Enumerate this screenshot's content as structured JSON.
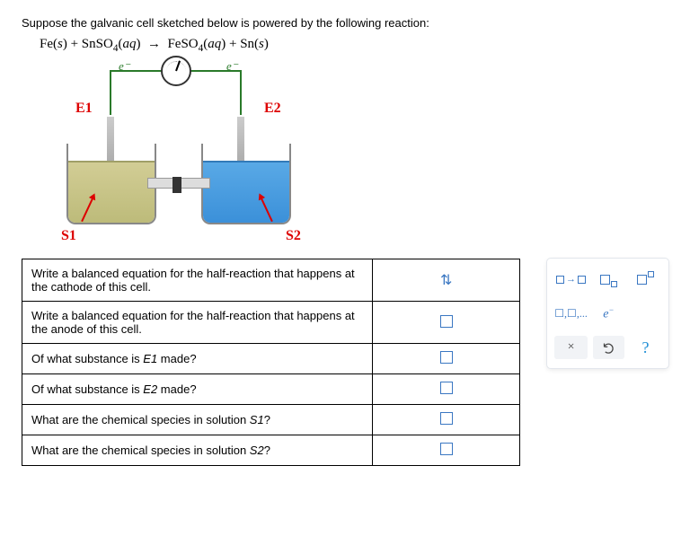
{
  "prompt": "Suppose the galvanic cell sketched below is powered by the following reaction:",
  "equation_html": "Fe(<span class='ital'>s</span>) + SnSO<span class='sub'>4</span>(<span class='ital'>aq</span>) &nbsp;→&nbsp; FeSO<span class='sub'>4</span>(<span class='ital'>aq</span>) + Sn(<span class='ital'>s</span>)",
  "labels": {
    "e_minus": "e⁻",
    "E1": "E1",
    "E2": "E2",
    "S1": "S1",
    "S2": "S2"
  },
  "questions": [
    {
      "text": "Write a balanced equation for the half-reaction that happens at the cathode of this cell.",
      "special": "updown"
    },
    {
      "text": "Write a balanced equation for the half-reaction that happens at the anode of this cell.",
      "special": ""
    },
    {
      "text_html": "Of what substance is <i>E1</i> made?",
      "special": ""
    },
    {
      "text_html": "Of what substance is <i>E2</i> made?",
      "special": ""
    },
    {
      "text_html": "What are the chemical species in solution <i>S1</i>?",
      "special": ""
    },
    {
      "text_html": "What are the chemical species in solution <i>S2</i>?",
      "special": ""
    }
  ],
  "toolbox": {
    "yields": "→",
    "list_hint": "☐,☐,...",
    "electron_html": "<span class='e-italic'>e<sup>−</sup></span>",
    "close": "×",
    "undo": "↺",
    "help": "?"
  }
}
